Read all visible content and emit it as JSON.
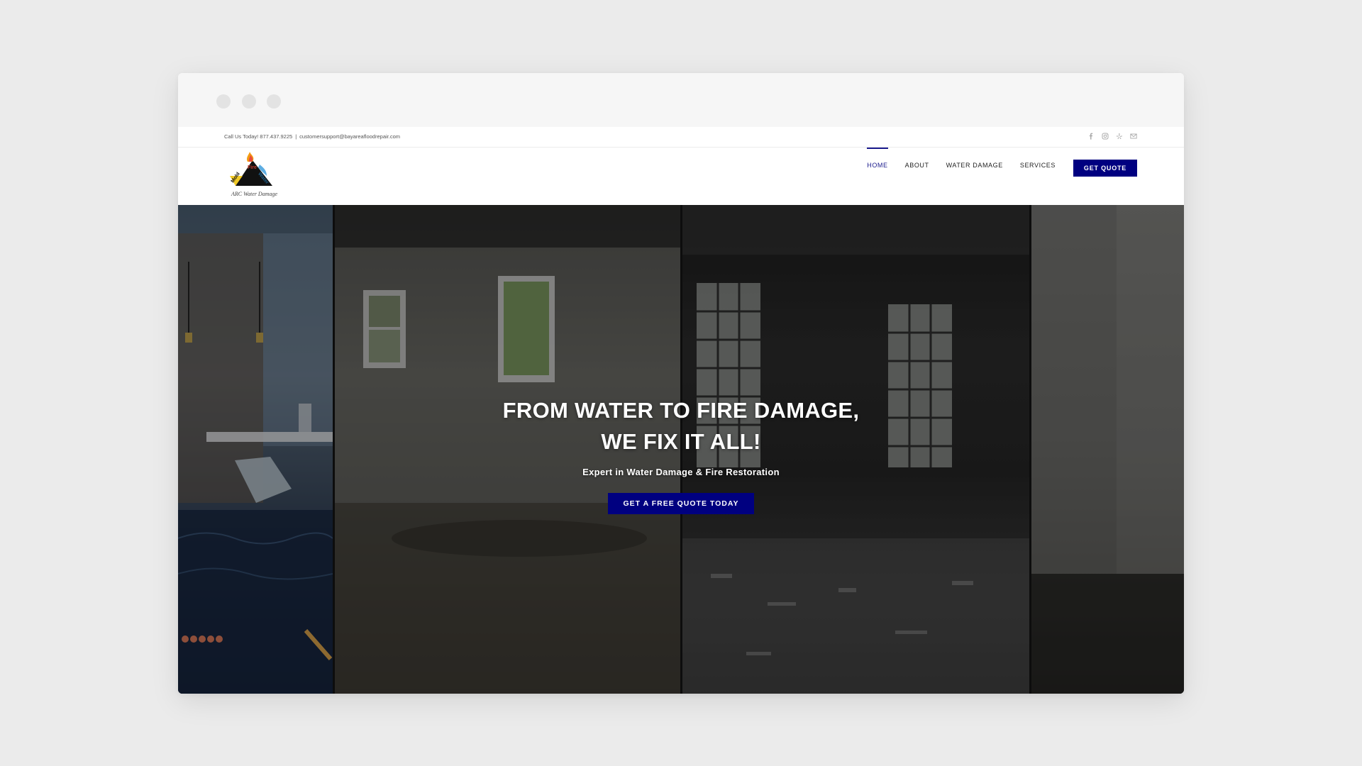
{
  "topbar": {
    "call_text": "Call Us Today! 877.437.9225",
    "separator": "|",
    "email": "customersupport@bayareafloodrepair.com",
    "social_icons": [
      "facebook-icon",
      "instagram-icon",
      "yelp-icon",
      "mail-icon"
    ]
  },
  "logo": {
    "name": "ARC Water Damage",
    "words": [
      "Mold",
      "Fire",
      "Water"
    ]
  },
  "nav": {
    "items": [
      {
        "label": "HOME",
        "active": true
      },
      {
        "label": "ABOUT",
        "active": false
      },
      {
        "label": "WATER DAMAGE",
        "active": false
      },
      {
        "label": "SERVICES",
        "active": false
      }
    ],
    "cta_label": "GET QUOTE"
  },
  "hero": {
    "title_line1": "FROM WATER TO FIRE DAMAGE,",
    "title_line2": "WE FIX IT ALL!",
    "subtitle": "Expert in Water Damage & Fire Restoration",
    "cta_label": "GET A FREE QUOTE TODAY"
  },
  "colors": {
    "accent": "#000080",
    "background": "#ebebeb",
    "chrome": "#f6f6f6"
  }
}
